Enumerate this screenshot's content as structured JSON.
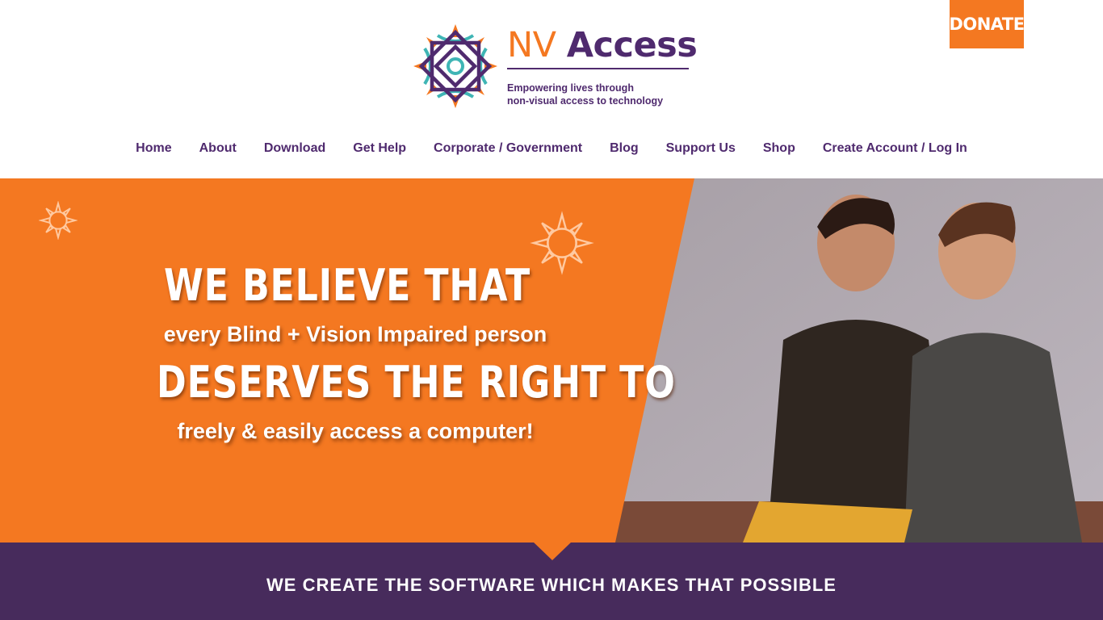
{
  "header": {
    "logo": {
      "name_part1": "NV",
      "name_part2": "Access",
      "tagline_line1": "Empowering lives through",
      "tagline_line2": "non-visual access to technology"
    },
    "donate_label": "DONATE"
  },
  "nav": {
    "items": [
      {
        "label": "Home"
      },
      {
        "label": "About"
      },
      {
        "label": "Download"
      },
      {
        "label": "Get Help"
      },
      {
        "label": "Corporate / Government"
      },
      {
        "label": "Blog"
      },
      {
        "label": "Support Us"
      },
      {
        "label": "Shop"
      },
      {
        "label": "Create Account / Log In"
      }
    ]
  },
  "hero": {
    "line1": "WE BELIEVE THAT",
    "line2": "every Blind + Vision Impaired person",
    "line3": "DESERVES THE RIGHT TO",
    "line4": "freely & easily access a computer!"
  },
  "band": {
    "text": "WE CREATE THE SOFTWARE WHICH MAKES THAT POSSIBLE"
  },
  "colors": {
    "orange": "#f47821",
    "purple": "#4f2a6e",
    "band_purple": "#472b5c",
    "teal": "#3fb5b5"
  },
  "icons": {
    "logo_mark": "nv-access-sun-icon",
    "decoration": "sun-outline-icon"
  }
}
